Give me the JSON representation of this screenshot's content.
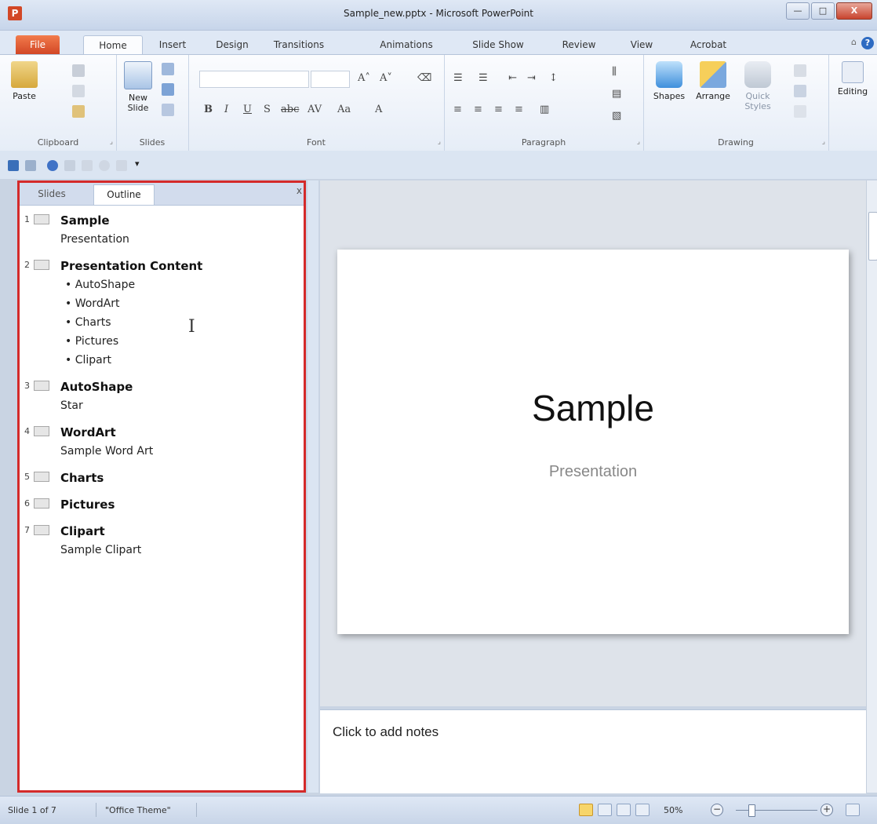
{
  "window": {
    "title": "Sample_new.pptx - Microsoft PowerPoint",
    "app_icon": "P",
    "minimize": "—",
    "maximize": "□",
    "close": "X"
  },
  "ribbon_tabs": [
    "File",
    "Home",
    "Insert",
    "Design",
    "Transitions",
    "Animations",
    "Slide Show",
    "Review",
    "View",
    "Acrobat"
  ],
  "active_tab": "Home",
  "ribbon": {
    "clipboard": {
      "label": "Clipboard",
      "paste": "Paste"
    },
    "slides": {
      "label": "Slides",
      "new_slide": "New Slide"
    },
    "font": {
      "label": "Font"
    },
    "paragraph": {
      "label": "Paragraph"
    },
    "drawing": {
      "label": "Drawing",
      "shapes": "Shapes",
      "arrange": "Arrange",
      "quick_styles": "Quick Styles"
    },
    "editing": {
      "label": "Editing"
    }
  },
  "left_pane": {
    "tabs": [
      "Slides",
      "Outline"
    ],
    "active": "Outline",
    "close": "x",
    "slides": [
      {
        "num": "1",
        "title": "Sample",
        "sub": "Presentation",
        "bullets": []
      },
      {
        "num": "2",
        "title": "Presentation Content",
        "sub": "",
        "bullets": [
          "AutoShape",
          "WordArt",
          "Charts",
          "Pictures",
          "Clipart"
        ]
      },
      {
        "num": "3",
        "title": "AutoShape",
        "sub": "Star",
        "bullets": []
      },
      {
        "num": "4",
        "title": "WordArt",
        "sub": "Sample Word Art",
        "bullets": []
      },
      {
        "num": "5",
        "title": "Charts",
        "sub": "",
        "bullets": []
      },
      {
        "num": "6",
        "title": "Pictures",
        "sub": "",
        "bullets": []
      },
      {
        "num": "7",
        "title": "Clipart",
        "sub": "Sample Clipart",
        "bullets": []
      }
    ]
  },
  "slide": {
    "title": "Sample",
    "subtitle": "Presentation"
  },
  "notes": {
    "placeholder": "Click to add notes"
  },
  "status_bar": {
    "slide_info": "Slide 1 of 7",
    "theme": "\"Office Theme\"",
    "zoom": "50%"
  }
}
